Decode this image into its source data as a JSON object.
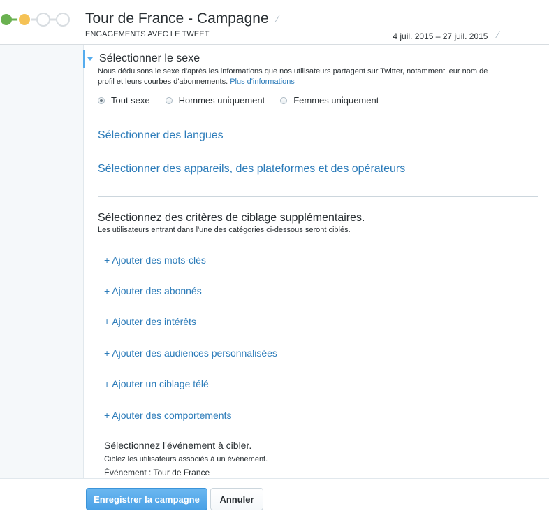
{
  "header": {
    "title": "Tour de France - Campagne",
    "objective": "ENGAGEMENTS AVEC LE TWEET",
    "dates": "4 juil. 2015 – 27 juil. 2015",
    "edit_icon": "pencil-icon",
    "progress_colors": {
      "done": "#6ab150",
      "current": "#f5c256",
      "pending": "#d8dde1"
    }
  },
  "gender": {
    "title": "Sélectionner le sexe",
    "description": "Nous déduisons le sexe d'après les informations que nos utilisateurs partagent sur Twitter, notamment leur nom de profil et leurs courbes d'abonnements.",
    "more_link": "Plus d'informations",
    "options": [
      {
        "label": "Tout sexe",
        "checked": true
      },
      {
        "label": "Hommes uniquement",
        "checked": false
      },
      {
        "label": "Femmes uniquement",
        "checked": false
      }
    ]
  },
  "languages_link": "Sélectionner des langues",
  "devices_link": "Sélectionner des appareils, des plateformes et des opérateurs",
  "criteria": {
    "title": "Sélectionnez des critères de ciblage supplémentaires.",
    "description": "Les utilisateurs entrant dans l'une des catégories ci-dessous seront ciblés.",
    "add_links": [
      "+ Ajouter des mots-clés",
      "+ Ajouter des abonnés",
      "+ Ajouter des intérêts",
      "+ Ajouter des audiences personnalisées",
      "+ Ajouter un ciblage télé",
      "+ Ajouter des comportements"
    ]
  },
  "event": {
    "title": "Sélectionnez l'événement à cibler.",
    "description": "Ciblez les utilisateurs associés à un événement.",
    "value": "Événement : Tour de France"
  },
  "footer": {
    "save_label": "Enregistrer la campagne",
    "cancel_label": "Annuler"
  }
}
